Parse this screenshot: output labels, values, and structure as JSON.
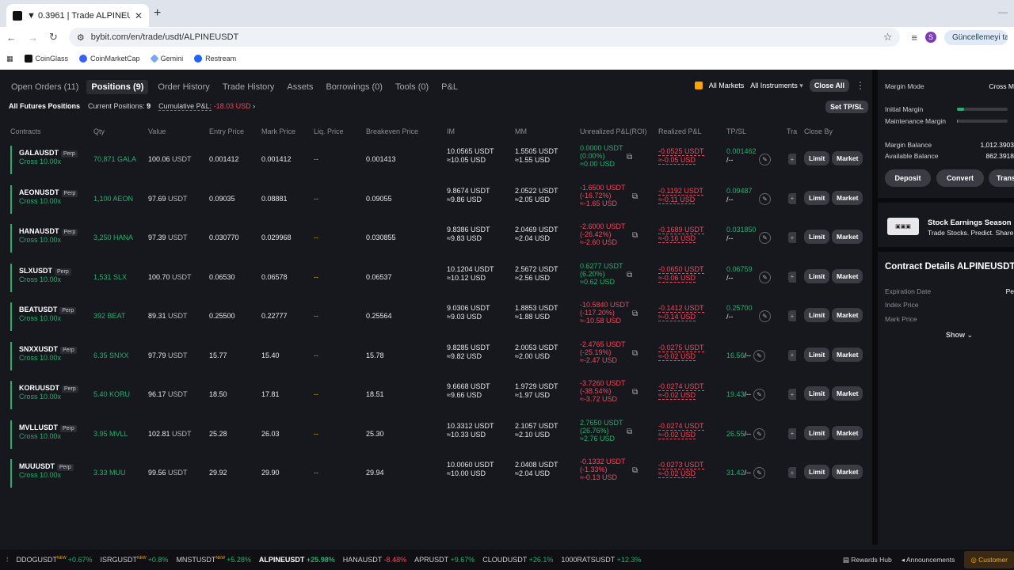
{
  "browser": {
    "tab_title": "▼ 0.3961 | Trade ALPINEUSDT |",
    "url": "bybit.com/en/trade/usdt/ALPINEUSDT",
    "profile_initial": "S",
    "update_button": "Güncellemeyi tamamla",
    "bookmarks": [
      "CoinGlass",
      "CoinMarketCap",
      "Gemini",
      "Restream"
    ]
  },
  "tabs": {
    "items": [
      "Open Orders (11)",
      "Positions (9)",
      "Order History",
      "Trade History",
      "Assets",
      "Borrowings (0)",
      "Tools (0)",
      "P&L"
    ],
    "active_index": 1,
    "all_markets": "All Markets",
    "all_instruments": "All Instruments",
    "close_all": "Close All"
  },
  "filter": {
    "all_futures": "All Futures Positions",
    "current_label": "Current Positions:",
    "current_value": "9",
    "cum_label": "Cumulative P&L:",
    "cum_value": "-18.03 USD",
    "set_tpsl": "Set TP/SL"
  },
  "columns": [
    "Contracts",
    "Qty",
    "Value",
    "Entry Price",
    "Mark Price",
    "Liq. Price",
    "Breakeven Price",
    "IM",
    "MM",
    "Unrealized P&L(ROI)",
    "Realized P&L",
    "TP/SL",
    "Tra",
    "Close By"
  ],
  "positions": [
    {
      "symbol": "GALAUSDT",
      "perp": "Perp",
      "cross": "Cross 10.00x",
      "qty": "70,871 GALA",
      "value": "100.06",
      "value_unit": "USDT",
      "entry": "0.001412",
      "mark": "0.001412",
      "liq": "--",
      "breakeven": "0.001413",
      "im1": "10.0565 USDT",
      "im2": "≈10.05 USD",
      "mm1": "1.5505 USDT",
      "mm2": "≈1.55 USD",
      "upnl1": "0.0000 USDT",
      "upnl2": "(0.00%)",
      "upnl3": "≈0.00 USD",
      "upnl_sign": "pos",
      "rpnl1": "-0.0525 USDT",
      "rpnl2": "≈-0.05 USD",
      "tp": "0.001462",
      "sl": "/--"
    },
    {
      "symbol": "AEONUSDT",
      "perp": "Perp",
      "cross": "Cross 10.00x",
      "qty": "1,100 AEON",
      "value": "97.69",
      "value_unit": "USDT",
      "entry": "0.09035",
      "mark": "0.08881",
      "liq": "--",
      "breakeven": "0.09055",
      "im1": "9.8674 USDT",
      "im2": "≈9.86 USD",
      "mm1": "2.0522 USDT",
      "mm2": "≈2.05 USD",
      "upnl1": "-1.6500 USDT",
      "upnl2": "(-16.72%)",
      "upnl3": "≈-1.65 USD",
      "upnl_sign": "neg",
      "rpnl1": "-0.1192 USDT",
      "rpnl2": "≈-0.11 USD",
      "tp": "0.09487",
      "sl": "/--"
    },
    {
      "symbol": "HANAUSDT",
      "perp": "Perp",
      "cross": "Cross 10.00x",
      "qty": "3,250 HANA",
      "value": "97.39",
      "value_unit": "USDT",
      "entry": "0.030770",
      "mark": "0.029968",
      "liq": "--",
      "breakeven": "0.030855",
      "im1": "9.8386 USDT",
      "im2": "≈9.83 USD",
      "mm1": "2.0469 USDT",
      "mm2": "≈2.04 USD",
      "upnl1": "-2.6000 USDT",
      "upnl2": "(-26.42%)",
      "upnl3": "≈-2.60 USD",
      "upnl_sign": "neg",
      "rpnl1": "-0.1689 USDT",
      "rpnl2": "≈-0.16 USD",
      "tp": "0.031850",
      "sl": "/--"
    },
    {
      "symbol": "SLXUSDT",
      "perp": "Perp",
      "cross": "Cross 10.00x",
      "qty": "1,531 SLX",
      "value": "100.70",
      "value_unit": "USDT",
      "entry": "0.06530",
      "mark": "0.06578",
      "liq": "--",
      "breakeven": "0.06537",
      "im1": "10.1204 USDT",
      "im2": "≈10.12 USD",
      "mm1": "2.5672 USDT",
      "mm2": "≈2.56 USD",
      "upnl1": "0.6277 USDT",
      "upnl2": "(6.20%)",
      "upnl3": "≈0.62 USD",
      "upnl_sign": "pos",
      "rpnl1": "-0.0650 USDT",
      "rpnl2": "≈-0.06 USD",
      "tp": "0.06759",
      "sl": "/--"
    },
    {
      "symbol": "BEATUSDT",
      "perp": "Perp",
      "cross": "Cross 10.00x",
      "qty": "392 BEAT",
      "value": "89.31",
      "value_unit": "USDT",
      "entry": "0.25500",
      "mark": "0.22777",
      "liq": "--",
      "breakeven": "0.25564",
      "im1": "9.0306 USDT",
      "im2": "≈9.03 USD",
      "mm1": "1.8853 USDT",
      "mm2": "≈1.88 USD",
      "upnl1": "-10.5840 USDT",
      "upnl2": "(-117.20%)",
      "upnl3": "≈-10.58 USD",
      "upnl_sign": "neg",
      "rpnl1": "-0.1412 USDT",
      "rpnl2": "≈-0.14 USD",
      "tp": "0.25700",
      "sl": "/--"
    },
    {
      "symbol": "SNXXUSDT",
      "perp": "Perp",
      "cross": "Cross 10.00x",
      "qty": "6.35 SNXX",
      "value": "97.79",
      "value_unit": "USDT",
      "entry": "15.77",
      "mark": "15.40",
      "liq": "--",
      "breakeven": "15.78",
      "im1": "9.8285 USDT",
      "im2": "≈9.82 USD",
      "mm1": "2.0053 USDT",
      "mm2": "≈2.00 USD",
      "upnl1": "-2.4765 USDT",
      "upnl2": "(-25.19%)",
      "upnl3": "≈-2.47 USD",
      "upnl_sign": "neg",
      "rpnl1": "-0.0275 USDT",
      "rpnl2": "≈-0.02 USD",
      "tp": "16.56",
      "sl": "/--"
    },
    {
      "symbol": "KORUUSDT",
      "perp": "Perp",
      "cross": "Cross 10.00x",
      "qty": "5.40 KORU",
      "value": "96.17",
      "value_unit": "USDT",
      "entry": "18.50",
      "mark": "17.81",
      "liq": "--",
      "breakeven": "18.51",
      "im1": "9.6668 USDT",
      "im2": "≈9.66 USD",
      "mm1": "1.9729 USDT",
      "mm2": "≈1.97 USD",
      "upnl1": "-3.7260 USDT",
      "upnl2": "(-38.54%)",
      "upnl3": "≈-3.72 USD",
      "upnl_sign": "neg",
      "rpnl1": "-0.0274 USDT",
      "rpnl2": "≈-0.02 USD",
      "tp": "19.43",
      "sl": "/--"
    },
    {
      "symbol": "MVLLUSDT",
      "perp": "Perp",
      "cross": "Cross 10.00x",
      "qty": "3.95 MVLL",
      "value": "102.81",
      "value_unit": "USDT",
      "entry": "25.28",
      "mark": "26.03",
      "liq": "--",
      "breakeven": "25.30",
      "im1": "10.3312 USDT",
      "im2": "≈10.33 USD",
      "mm1": "2.1057 USDT",
      "mm2": "≈2.10 USD",
      "upnl1": "2.7650 USDT",
      "upnl2": "(26.76%)",
      "upnl3": "≈2.76 USD",
      "upnl_sign": "pos",
      "rpnl1": "-0.0274 USDT",
      "rpnl2": "≈-0.02 USD",
      "tp": "26.55",
      "sl": "/--"
    },
    {
      "symbol": "MUUUSDT",
      "perp": "Perp",
      "cross": "Cross 10.00x",
      "qty": "3.33 MUU",
      "value": "99.56",
      "value_unit": "USDT",
      "entry": "29.92",
      "mark": "29.90",
      "liq": "--",
      "breakeven": "29.94",
      "im1": "10.0060 USDT",
      "im2": "≈10.00 USD",
      "mm1": "2.0408 USDT",
      "mm2": "≈2.04 USD",
      "upnl1": "-0.1332 USDT",
      "upnl2": "(-1.33%)",
      "upnl3": "≈-0.13 USD",
      "upnl_sign": "neg",
      "rpnl1": "-0.0273 USDT",
      "rpnl2": "≈-0.02 USD",
      "tp": "31.42",
      "sl": "/--"
    }
  ],
  "row_buttons": {
    "limit": "Limit",
    "market": "Market"
  },
  "right": {
    "margin_mode_label": "Margin Mode",
    "margin_mode_value": "Cross M",
    "initial_margin": "Initial Margin",
    "maintenance_margin": "Maintenance Margin",
    "initial_margin_fill": 0.14,
    "maintenance_margin_fill": 0.02,
    "margin_balance_label": "Margin Balance",
    "margin_balance_value": "1,012.3903",
    "available_balance_label": "Available Balance",
    "available_balance_value": "862.3918",
    "deposit": "Deposit",
    "convert": "Convert",
    "transfer": "Trans",
    "promo_title": "Stock Earnings Season",
    "promo_sub": "Trade Stocks. Predict. Share",
    "contract_title": "Contract Details ALPINEUSDT",
    "expiration": "Expiration Date",
    "expiration_value": "Pe",
    "index_price": "Index Price",
    "mark_price": "Mark Price",
    "show": "Show"
  },
  "ticker": [
    {
      "sym": "DDOGUSDT",
      "new": true,
      "chg": "+0.67%",
      "dir": "up"
    },
    {
      "sym": "ISRGUSDT",
      "new": true,
      "chg": "+0.8%",
      "dir": "up"
    },
    {
      "sym": "MNSTUSDT",
      "new": true,
      "chg": "+5.28%",
      "dir": "up"
    },
    {
      "sym": "ALPINEUSDT",
      "new": false,
      "chg": "+25.98%",
      "dir": "up",
      "bold": true
    },
    {
      "sym": "HANAUSDT",
      "new": false,
      "chg": "-8.48%",
      "dir": "dn"
    },
    {
      "sym": "APRUSDT",
      "new": false,
      "chg": "+9.67%",
      "dir": "up"
    },
    {
      "sym": "CLOUDUSDT",
      "new": false,
      "chg": "+26.1%",
      "dir": "up"
    },
    {
      "sym": "1000RATSUSDT",
      "new": false,
      "chg": "+12.3%",
      "dir": "up"
    }
  ],
  "footer": {
    "rewards": "Rewards Hub",
    "announcements": "Announcements",
    "customer": "Customer"
  },
  "new_label": "NEW"
}
